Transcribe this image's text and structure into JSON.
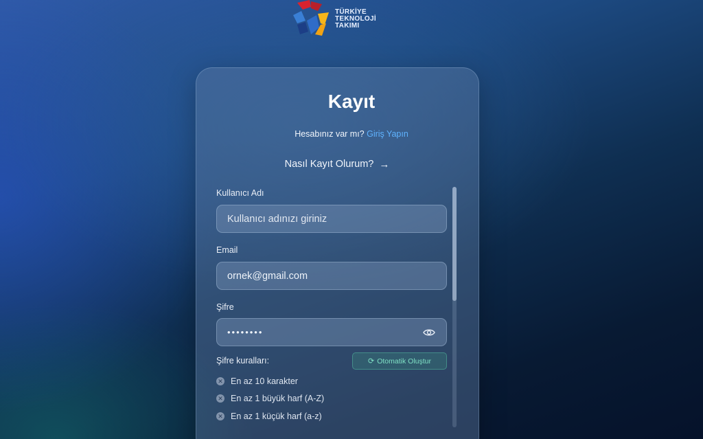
{
  "logo": {
    "lines": [
      "TÜRKİYE",
      "TEKNOLOJİ",
      "TAKIMI"
    ],
    "colors": {
      "red": "#d9232e",
      "yellow": "#f7b61b",
      "blue": "#3a7fd5",
      "dark_blue": "#1c3e86"
    }
  },
  "form": {
    "title": "Kayıt",
    "login_prompt": "Hesabınız var mı?",
    "login_link": "Giriş Yapın",
    "howto_label": "Nasıl Kayıt Olurum?",
    "howto_icon": "arrow-right-icon",
    "username": {
      "label": "Kullanıcı Adı",
      "placeholder": "Kullanıcı adınızı giriniz",
      "value": ""
    },
    "email": {
      "label": "Email",
      "placeholder": "",
      "value": "ornek@gmail.com"
    },
    "password": {
      "label": "Şifre",
      "masked_value": "••••••••",
      "toggle_icon": "eye-icon"
    },
    "rules": {
      "title": "Şifre kuralları:",
      "auto_generate_label": "Otomatik Oluştur",
      "auto_generate_icon": "refresh-icon",
      "items": [
        {
          "text": "En az 10 karakter",
          "status_icon": "x-circle-icon"
        },
        {
          "text": "En az 1 büyük harf (A-Z)",
          "status_icon": "x-circle-icon"
        },
        {
          "text": "En az 1 küçük harf (a-z)",
          "status_icon": "x-circle-icon"
        }
      ]
    }
  },
  "colors": {
    "link": "#5fb3ff",
    "accent_green": "#7fe0c4"
  }
}
